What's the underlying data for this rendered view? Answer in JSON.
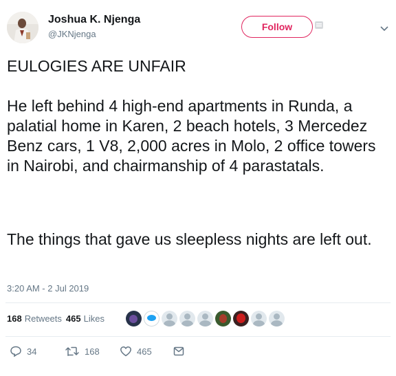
{
  "author": {
    "name": "Joshua K. Njenga",
    "handle": "@JKNjenga"
  },
  "follow_button": {
    "label": "Follow"
  },
  "tweet": {
    "paragraph_1": "EULOGIES ARE UNFAIR",
    "paragraph_2": "He left behind 4 high-end apartments in Runda, a palatial home in Karen, 2 beach hotels, 3 Mercedez Benz cars, 1 V8, 2,000 acres in Molo, 2 office towers in Nairobi, and chairmanship of 4 parastatals.",
    "paragraph_3": "The things that gave us sleepless nights are left out.",
    "timestamp": "3:20 AM - 2 Jul 2019"
  },
  "stats": {
    "retweets_count": "168",
    "retweets_label": "Retweets",
    "likes_count": "465",
    "likes_label": "Likes"
  },
  "actions": {
    "reply_count": "34",
    "retweet_count": "168",
    "like_count": "465"
  },
  "icons": {
    "reply": "reply-icon",
    "retweet": "retweet-icon",
    "like": "heart-icon",
    "message": "envelope-icon",
    "caret": "chevron-down-icon"
  },
  "colors": {
    "follow": "#e0245e",
    "text": "#14171a",
    "secondary": "#657786",
    "divider": "#e6ecf0"
  }
}
